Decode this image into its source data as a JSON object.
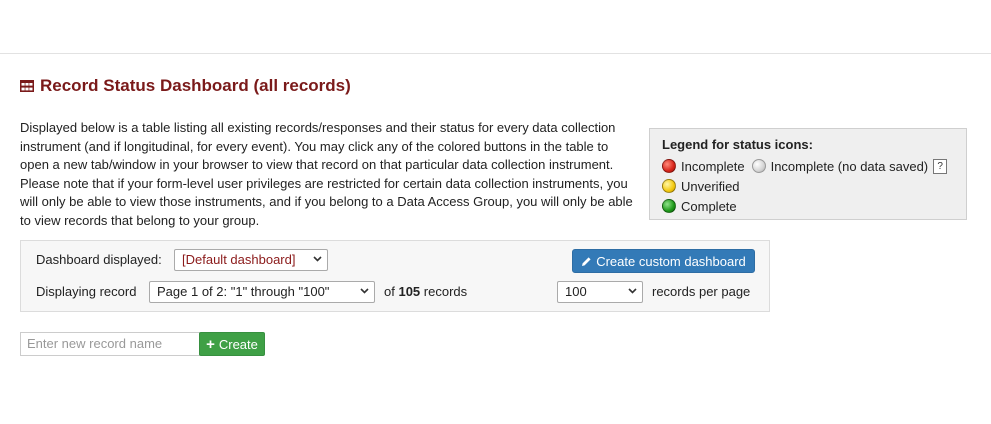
{
  "page": {
    "title": "Record Status Dashboard (all records)",
    "intro": "Displayed below is a table listing all existing records/responses and their status for every data collection instrument (and if longitudinal, for every event). You may click any of the colored buttons in the table to open a new tab/window in your browser to view that record on that particular data collection instrument. Please note that if your form-level user privileges are restricted for certain data collection instruments, you will only be able to view those instruments, and if you belong to a Data Access Group, you will only be able to view records that belong to your group."
  },
  "legend": {
    "heading": "Legend for status icons:",
    "incomplete": "Incomplete",
    "incomplete_no_data": "Incomplete (no data saved)",
    "help": "?",
    "unverified": "Unverified",
    "complete": "Complete"
  },
  "controls": {
    "dashboard_label": "Dashboard displayed:",
    "dashboard_value": "[Default dashboard]",
    "create_custom_label": "Create custom dashboard",
    "displaying_label": "Displaying record",
    "page_value": "Page 1 of 2: \"1\" through \"100\"",
    "of_label": "of",
    "record_count": "105",
    "records_label": "records",
    "per_page_value": "100",
    "per_page_label": "records per page"
  },
  "new_record": {
    "placeholder": "Enter new record name",
    "create_label": "Create"
  },
  "colors": {
    "title": "#7a1a1a",
    "primary_button": "#337ab7",
    "create_button": "#3fa046",
    "dropdown_text": "#8b1a1a"
  }
}
